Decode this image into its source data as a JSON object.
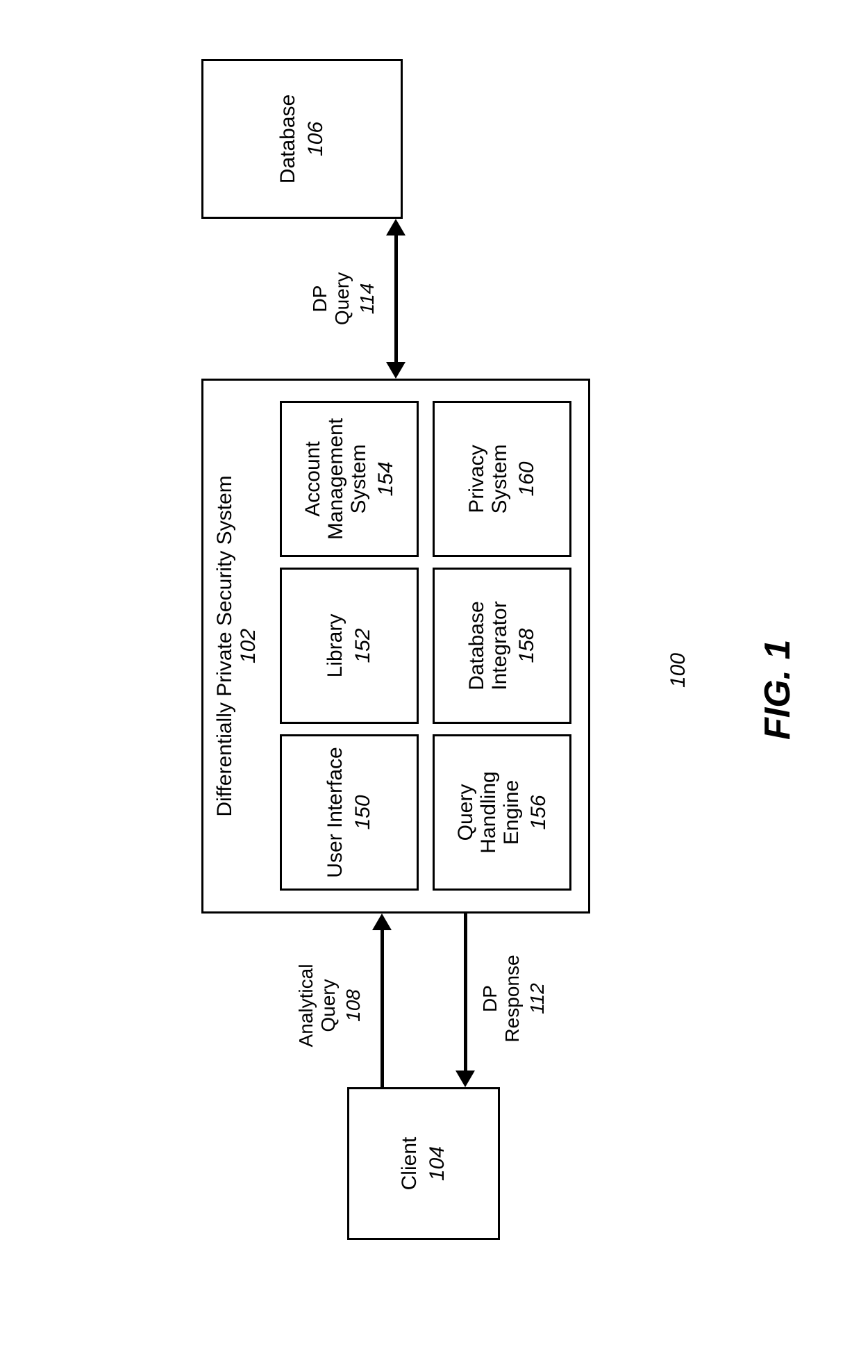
{
  "figure_ref": "100",
  "figure_label": "FIG. 1",
  "client": {
    "title": "Client",
    "num": "104"
  },
  "system": {
    "title": "Differentially Private Security System",
    "num": "102",
    "modules": {
      "user_interface": {
        "title": "User Interface",
        "num": "150"
      },
      "library": {
        "title": "Library",
        "num": "152"
      },
      "account_mgmt": {
        "title_l1": "Account",
        "title_l2": "Management",
        "title_l3": "System",
        "num": "154"
      },
      "query_engine": {
        "title_l1": "Query",
        "title_l2": "Handling",
        "title_l3": "Engine",
        "num": "156"
      },
      "db_integrator": {
        "title_l1": "Database",
        "title_l2": "Integrator",
        "num": "158"
      },
      "privacy": {
        "title_l1": "Privacy",
        "title_l2": "System",
        "num": "160"
      }
    }
  },
  "database": {
    "title": "Database",
    "num": "106"
  },
  "arrows": {
    "analytical_query": {
      "label_l1": "Analytical",
      "label_l2": "Query",
      "num": "108"
    },
    "dp_response": {
      "label_l1": "DP",
      "label_l2": "Response",
      "num": "112"
    },
    "dp_query": {
      "label_l1": "DP",
      "label_l2": "Query",
      "num": "114"
    }
  }
}
